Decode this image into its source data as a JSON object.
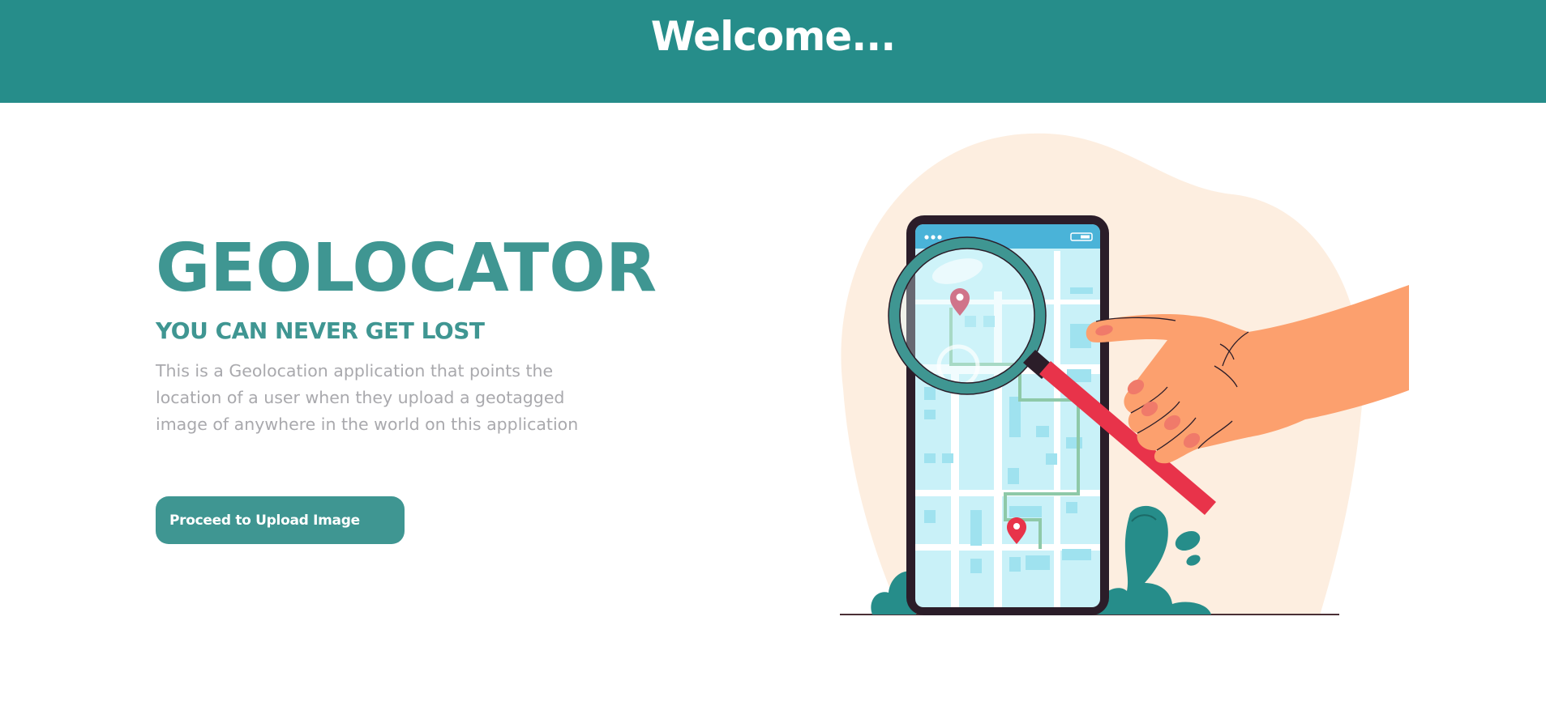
{
  "header": {
    "title": "Welcome..."
  },
  "hero": {
    "app_name": "GEOLOCATOR",
    "tagline": "YOU CAN NEVER GET LOST",
    "description": "This is a Geolocation application that points the location of a user when they upload a geotagged image of anywhere in the world on this application",
    "cta_label": "Proceed to Upload Image"
  },
  "illustration": {
    "icon": "phone-map-magnifier-illustration"
  },
  "colors": {
    "primary": "#268d8a",
    "accent": "#3f9692",
    "text_muted": "#a9a9ad",
    "blob": "#fdeee0",
    "pin": "#e8334a",
    "hand": "#fca06e"
  }
}
